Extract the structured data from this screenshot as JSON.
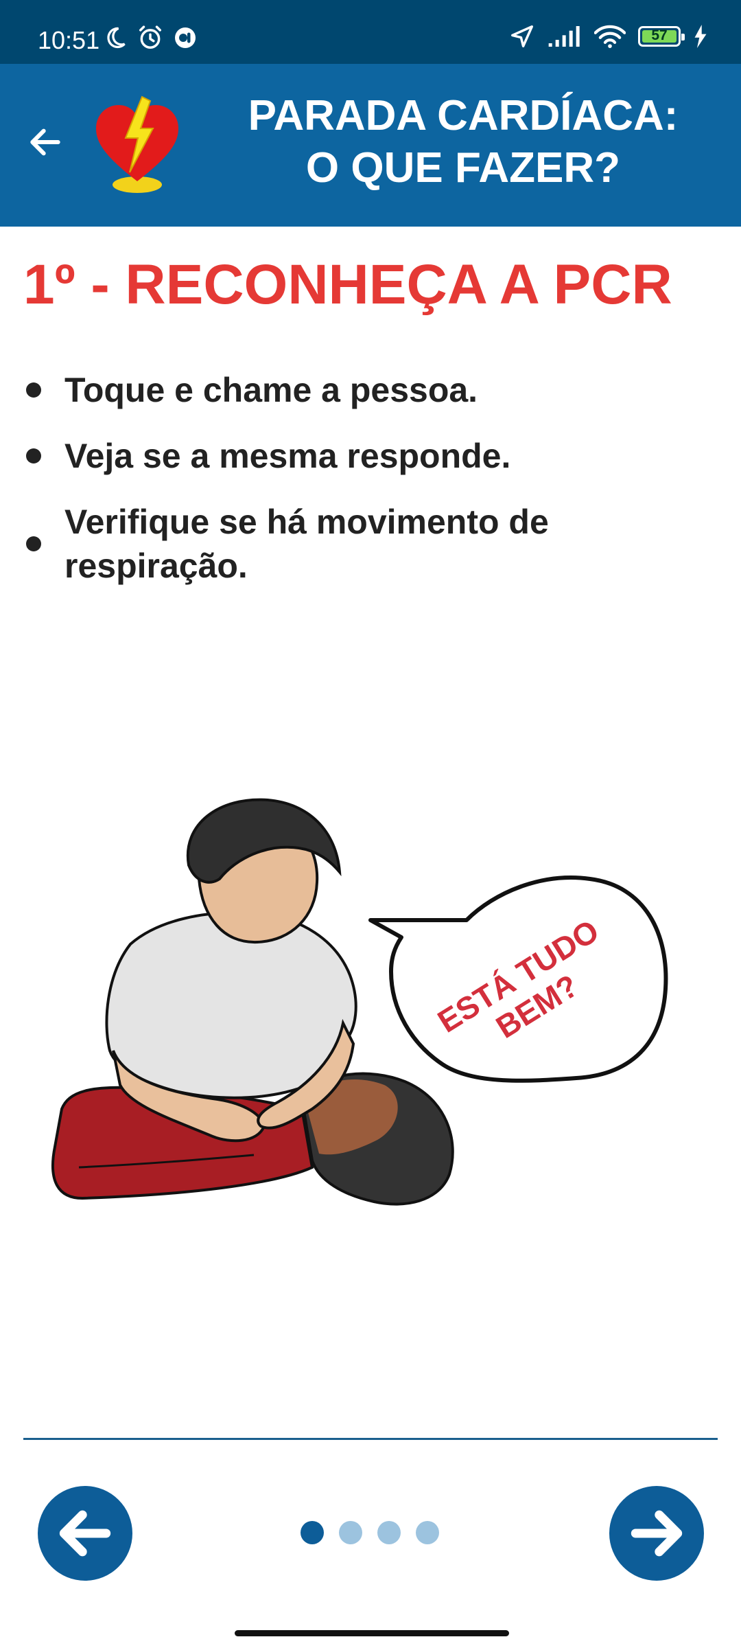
{
  "status_bar": {
    "time": "10:51",
    "battery_level": "57",
    "icons": [
      "moon-icon",
      "alarm-icon",
      "app-notification-icon",
      "location-arrow-icon",
      "signal-icon",
      "wifi-icon",
      "battery-icon",
      "charging-bolt-icon"
    ]
  },
  "app_bar": {
    "title": "PARADA CARDÍACA:\nO QUE FAZER?",
    "back_icon": "arrow-left-icon",
    "logo_icon": "heart-lightning-icon"
  },
  "content": {
    "step_title": "1º - RECONHEÇA A PCR",
    "bullets": [
      "Toque e chame a pessoa.",
      "Veja se a mesma responde.",
      "Verifique se há movimento de respiração."
    ],
    "illustration": {
      "speech_bubble_line1": "ESTÁ TUDO",
      "speech_bubble_line2": "BEM?"
    }
  },
  "navigation": {
    "prev_icon": "arrow-left-icon",
    "next_icon": "arrow-right-icon",
    "pages_total": 4,
    "current_page": 1
  },
  "colors": {
    "status_bar": "#00476f",
    "app_bar": "#0d65a0",
    "title_red": "#e53935",
    "nav_blue": "#0d5d98",
    "pager_inactive": "#9cc3df"
  }
}
